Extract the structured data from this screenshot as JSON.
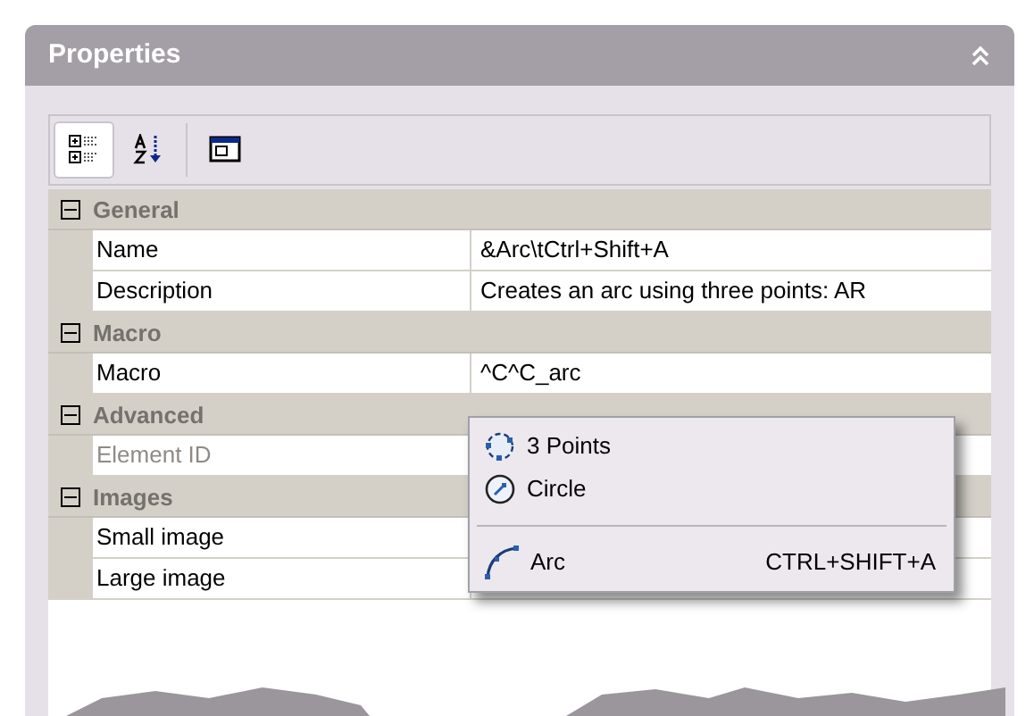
{
  "panel": {
    "title": "Properties"
  },
  "toolbar": [
    {
      "kind": "categorized",
      "selected": true
    },
    {
      "kind": "alphabetical",
      "selected": false
    },
    {
      "kind": "pages",
      "selected": false
    }
  ],
  "grid": [
    {
      "kind": "category",
      "label": "General",
      "expanded": true
    },
    {
      "kind": "property",
      "label": "Name",
      "value": "&Arc\\tCtrl+Shift+A",
      "disabled": false
    },
    {
      "kind": "property",
      "label": "Description",
      "value": "Creates an arc using three points:  AR",
      "disabled": false
    },
    {
      "kind": "category",
      "label": "Macro",
      "expanded": true
    },
    {
      "kind": "property",
      "label": "Macro",
      "value": "^C^C_arc",
      "disabled": false
    },
    {
      "kind": "category",
      "label": "Advanced",
      "expanded": true
    },
    {
      "kind": "property",
      "label": "Element ID",
      "disabled": true
    },
    {
      "kind": "category",
      "label": "Images",
      "expanded": true
    },
    {
      "kind": "property",
      "label": "Small image",
      "disabled": false
    },
    {
      "kind": "property",
      "label": "Large image",
      "disabled": false
    }
  ],
  "menu": [
    {
      "kind": "points",
      "label": "3 Points"
    },
    {
      "kind": "circle",
      "label": "Circle"
    },
    {
      "kind": "separator"
    },
    {
      "kind": "arc",
      "label": "Arc",
      "shortcut": "CTRL+SHIFT+A"
    }
  ]
}
